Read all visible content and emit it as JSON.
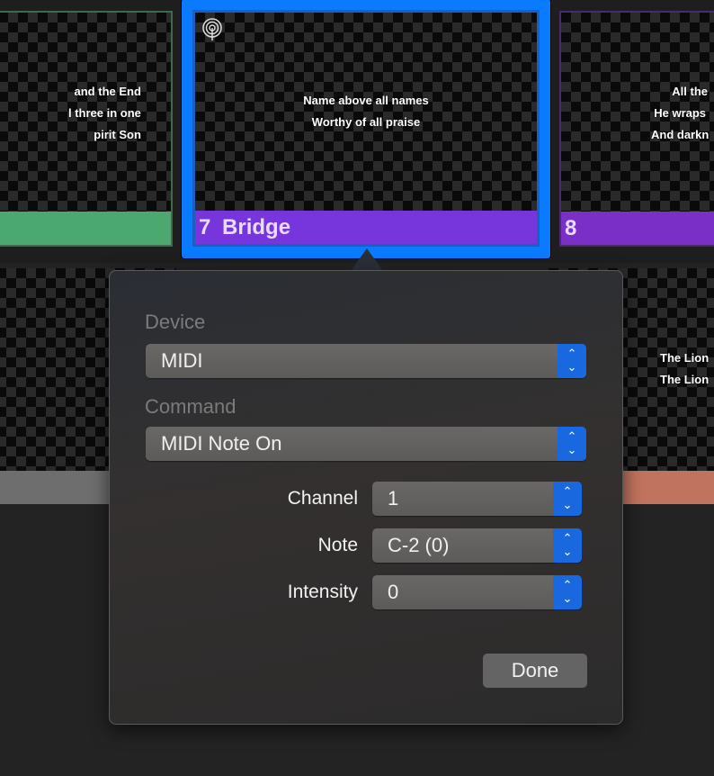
{
  "slides_top": [
    {
      "lyrics": [
        "and the End",
        "l three in one",
        "pirit Son"
      ],
      "bar_color": "#4aa870",
      "label": ""
    },
    {
      "number": "7",
      "label": "Bridge",
      "lyrics": [
        "Name above all names",
        "Worthy of all praise"
      ],
      "bar_color": "#7636dc",
      "selected": true,
      "icon": "broadcast-icon"
    },
    {
      "number": "8",
      "lyrics": [
        "All the",
        "He wraps",
        "And darkn"
      ],
      "bar_color": "#7a2fc6"
    }
  ],
  "slides_bottom": [
    {
      "lyrics": [],
      "bar_color": "#6e6e6e"
    },
    {
      "lyrics": [
        "The Lion",
        "The Lion"
      ],
      "bar_color": "#c0735e"
    }
  ],
  "popover": {
    "device_label": "Device",
    "device_value": "MIDI",
    "command_label": "Command",
    "command_value": "MIDI Note On",
    "channel_label": "Channel",
    "channel_value": "1",
    "note_label": "Note",
    "note_value": "C-2 (0)",
    "intensity_label": "Intensity",
    "intensity_value": "0",
    "done_label": "Done",
    "accent": "#1a68e0"
  }
}
